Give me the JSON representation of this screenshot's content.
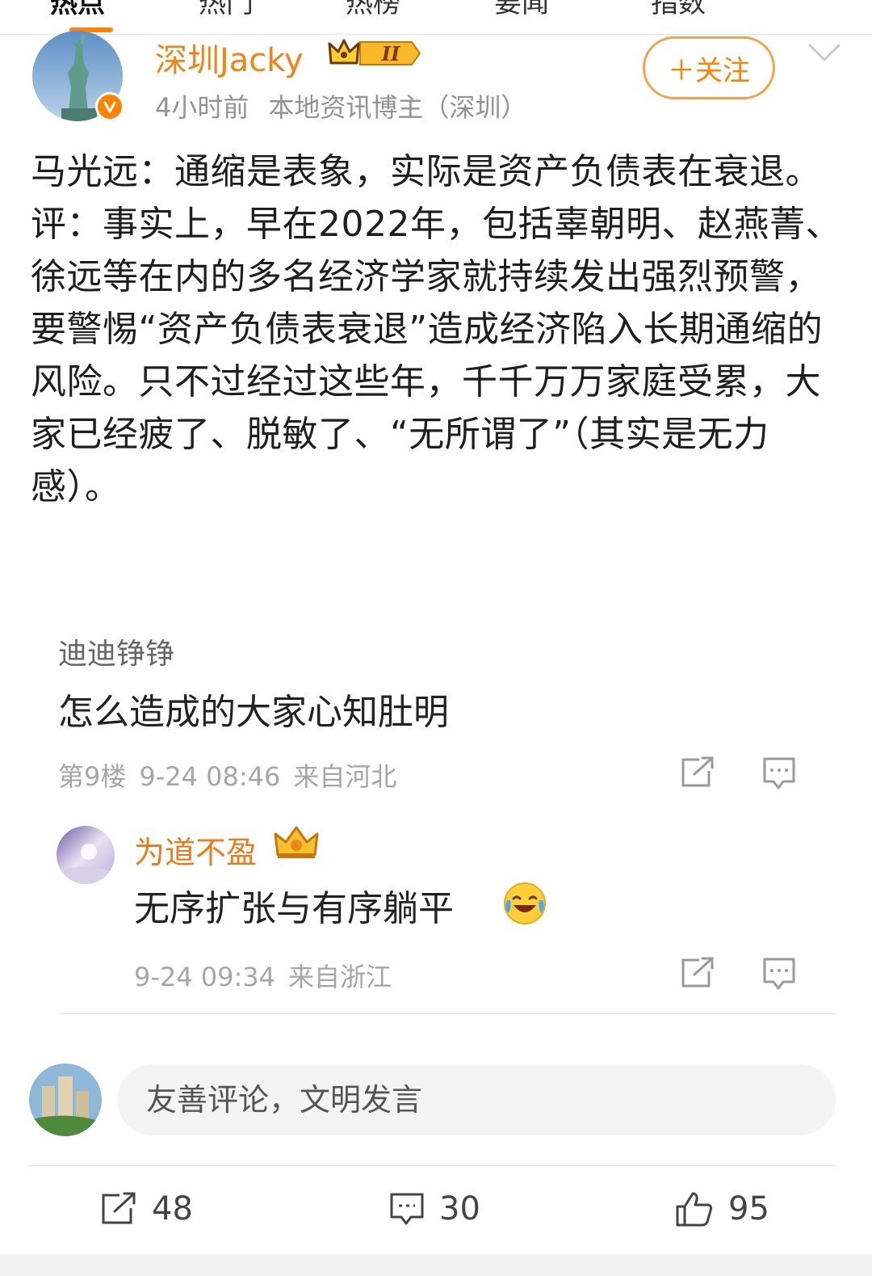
{
  "tabs": [
    "热点",
    "热门",
    "热榜",
    "要闻",
    "指数"
  ],
  "post": {
    "author": "深圳Jacky",
    "time": "4小时前",
    "source": "本地资讯博主（深圳）",
    "follow_label": "＋关注",
    "text_line1": "马光远：通缩是表象，实际是资产负债表在衰退。",
    "text_line2": "评：事实上，早在2022年，包括辜朝明、赵燕菁、徐远等在内的多名经济学家就持续发出强烈预警，要警惕“资产负债表衰退”造成经济陷入长期通缩的风险。只不过经过这些年，千千万万家庭受累，大家已经疲了、脱敏了、“无所谓了”（其实是无力感）。"
  },
  "comment": {
    "name": "迪迪铮铮",
    "text": "怎么造成的大家心知肚明",
    "floor": "第9楼",
    "time": "9-24 08:46",
    "location": "来自河北"
  },
  "reply": {
    "name": "为道不盈",
    "text": "无序扩张与有序躺平",
    "time": "9-24 09:34",
    "location": "来自浙江",
    "emoji": "laughing-crying-emoji"
  },
  "input": {
    "placeholder": "友善评论，文明发言"
  },
  "actions": {
    "reposts": "48",
    "comments": "30",
    "likes": "95"
  },
  "colors": {
    "accent": "#ff8200",
    "author_name": "#f08418",
    "meta_gray": "#939393"
  }
}
